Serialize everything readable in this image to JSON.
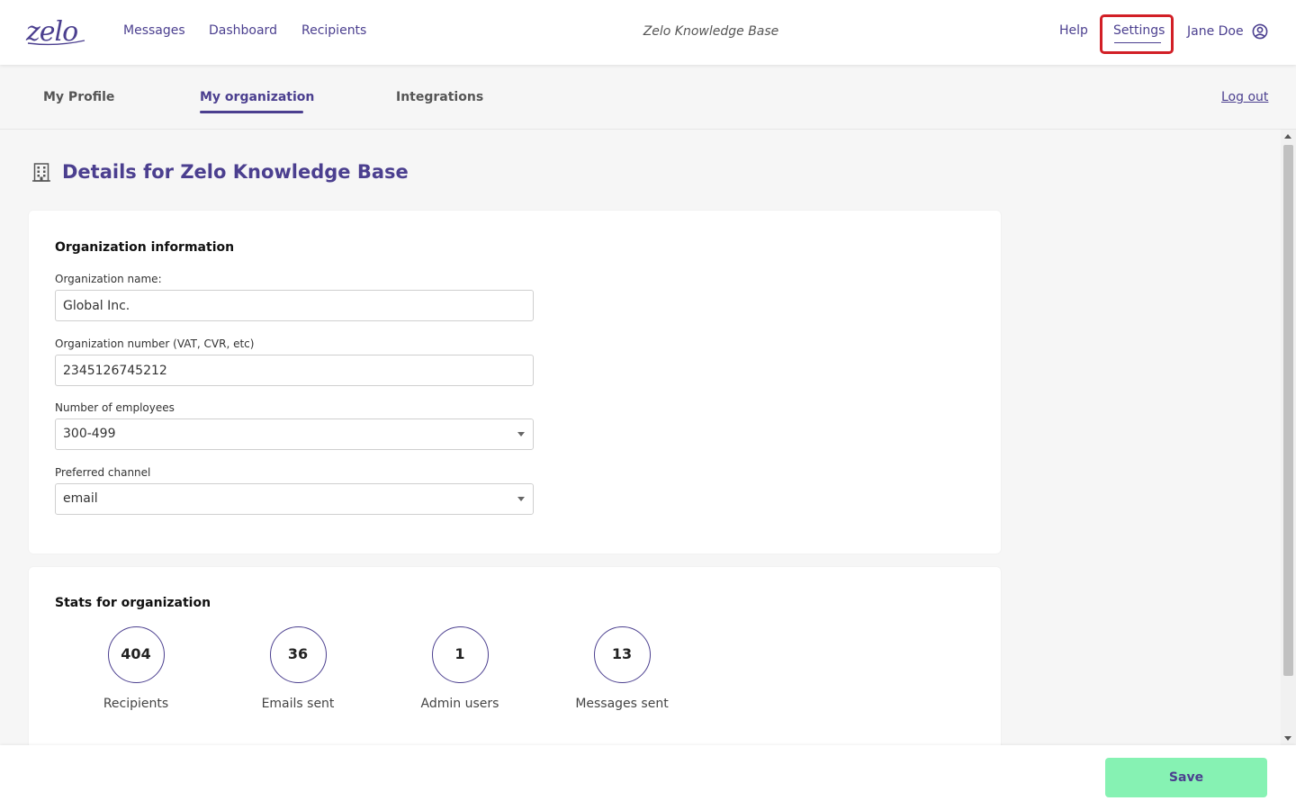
{
  "colors": {
    "brand": "#4b3f8f",
    "highlight": "#d21f26",
    "save_button": "#86f2b3",
    "page_bg": "#f6f6f6"
  },
  "header": {
    "logo": "zelo",
    "nav": [
      "Messages",
      "Dashboard",
      "Recipients"
    ],
    "title": "Zelo Knowledge Base",
    "help": "Help",
    "settings": "Settings",
    "user": "Jane Doe",
    "user_icon": "user-circle-icon"
  },
  "subnav": {
    "tabs": [
      "My Profile",
      "My organization",
      "Integrations"
    ],
    "active_tab": "My organization",
    "logout": "Log out"
  },
  "page": {
    "icon": "building-icon",
    "title": "Details for Zelo Knowledge Base"
  },
  "org_info": {
    "heading": "Organization information",
    "name_label": "Organization name:",
    "name_value": "Global Inc.",
    "number_label": "Organization number (VAT, CVR, etc)",
    "number_value": "2345126745212",
    "employees_label": "Number of employees",
    "employees_value": "300-499",
    "channel_label": "Preferred channel",
    "channel_value": "email"
  },
  "stats": {
    "heading": "Stats for organization",
    "items": [
      {
        "value": "404",
        "label": "Recipients"
      },
      {
        "value": "36",
        "label": "Emails sent"
      },
      {
        "value": "1",
        "label": "Admin users"
      },
      {
        "value": "13",
        "label": "Messages sent"
      }
    ]
  },
  "footer": {
    "save": "Save"
  }
}
